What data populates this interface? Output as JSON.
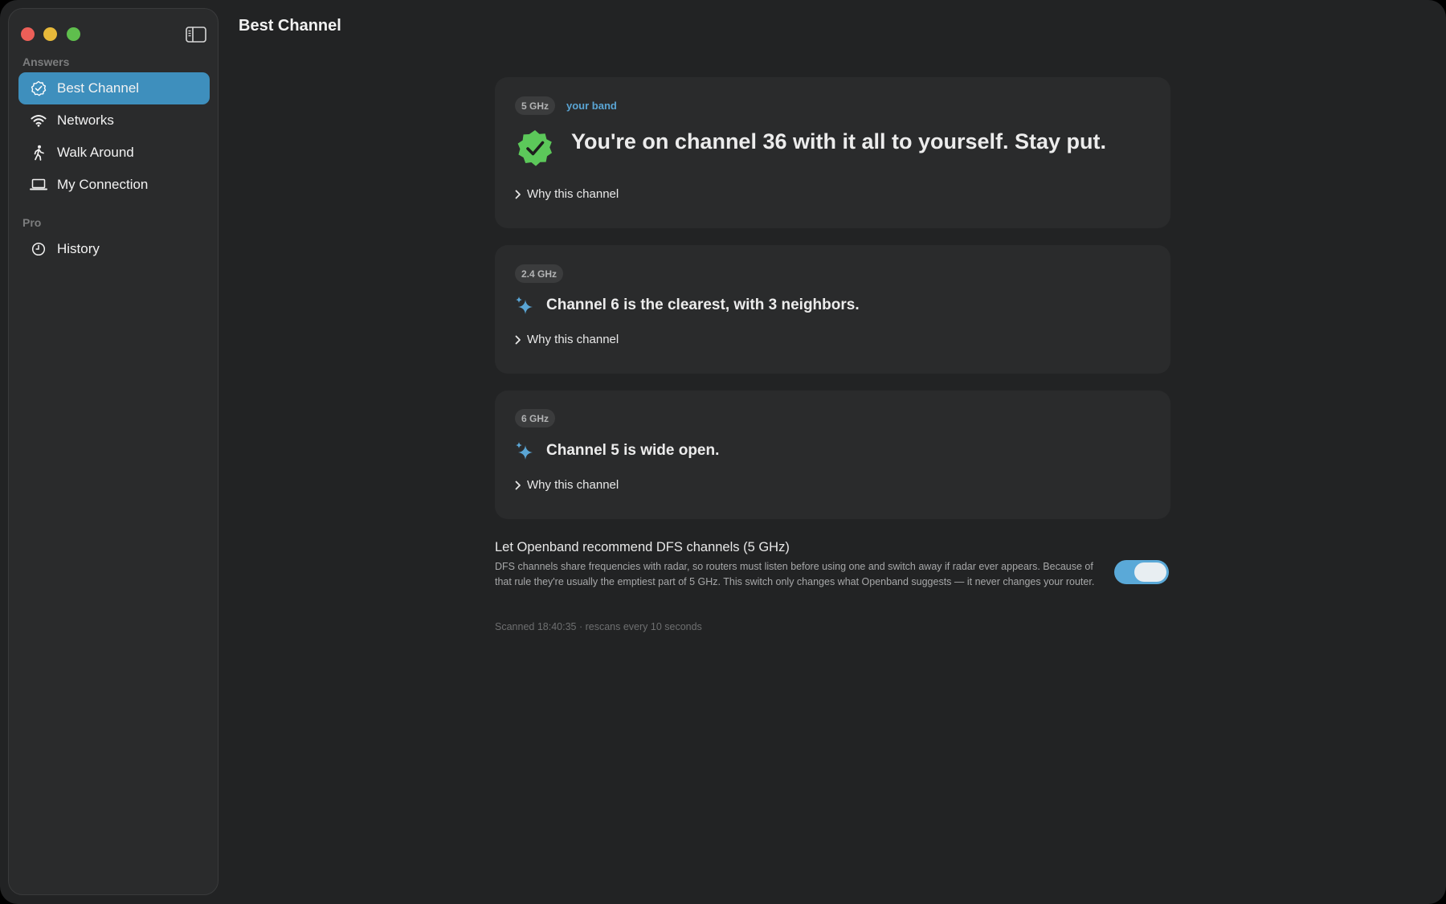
{
  "window": {
    "title": "Best Channel"
  },
  "sidebar": {
    "sections": [
      {
        "label": "Answers",
        "items": [
          {
            "label": "Best Channel",
            "icon": "verified-badge-icon",
            "active": true
          },
          {
            "label": "Networks",
            "icon": "wifi-icon",
            "active": false
          },
          {
            "label": "Walk Around",
            "icon": "walking-person-icon",
            "active": false
          },
          {
            "label": "My Connection",
            "icon": "laptop-icon",
            "active": false
          }
        ]
      },
      {
        "label": "Pro",
        "items": [
          {
            "label": "History",
            "icon": "clock-icon",
            "active": false
          }
        ]
      }
    ]
  },
  "cards": [
    {
      "band": "5 GHz",
      "tag": "your band",
      "icon": "verified-check-icon",
      "headline": "You're on channel 36 with it all to yourself. Stay put.",
      "disclosure": "Why this channel"
    },
    {
      "band": "2.4 GHz",
      "icon": "sparkle-icon",
      "headline": "Channel 6 is the clearest, with 3 neighbors.",
      "disclosure": "Why this channel"
    },
    {
      "band": "6 GHz",
      "icon": "sparkle-icon",
      "headline": "Channel 5 is wide open.",
      "disclosure": "Why this channel"
    }
  ],
  "dfs": {
    "title": "Let Openband recommend DFS channels (5 GHz)",
    "description": "DFS channels share frequencies with radar, so routers must listen before using one and switch away if radar ever appears. Because of that rule they're usually the emptiest part of 5 GHz. This switch only changes what Openband suggests — it never changes your router.",
    "enabled": true
  },
  "status": "Scanned 18:40:35 · rescans every 10 seconds",
  "colors": {
    "accent": "#3e8fbd",
    "toggle_on": "#5aa9d8",
    "verified_green": "#5cc85a",
    "sparkle_blue": "#5aa5d4",
    "background": "#222324"
  }
}
